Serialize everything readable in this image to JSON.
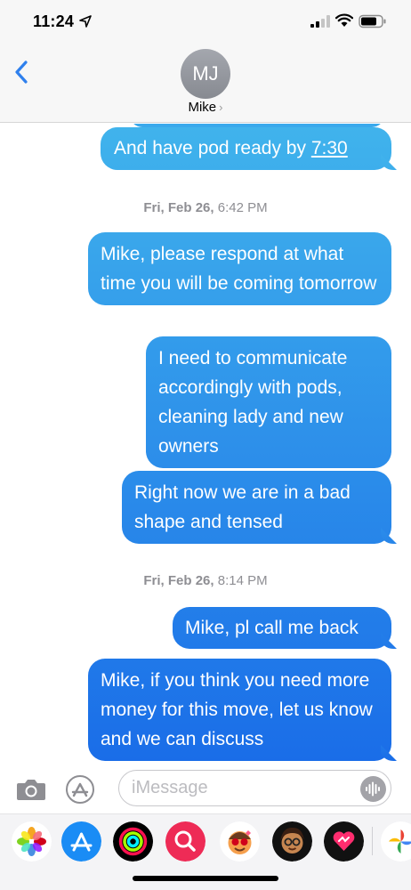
{
  "status_bar": {
    "time": "11:24"
  },
  "header": {
    "avatar_initials": "MJ",
    "contact_name": "Mike",
    "chevron": "›"
  },
  "messages": [
    {
      "type": "sent",
      "text_before": "And have pod ready by ",
      "link": "7:30"
    },
    {
      "type": "timestamp",
      "day": "Fri, Feb 26,",
      "time": "6:42 PM"
    },
    {
      "type": "sent",
      "text": "Mike, please respond at what time you will be coming tomorrow"
    },
    {
      "type": "sent",
      "text": "I need to communicate accordingly with pods, cleaning lady and new owners"
    },
    {
      "type": "sent",
      "text": "Right now we are in a bad shape and tensed"
    },
    {
      "type": "timestamp",
      "day": "Fri, Feb 26,",
      "time": "8:14 PM"
    },
    {
      "type": "sent",
      "text": "Mike, pl call me back"
    },
    {
      "type": "sent",
      "text": "Mike, if you think you need more money for this move, let us know and we can discuss"
    }
  ],
  "composer": {
    "placeholder": "iMessage"
  },
  "app_drawer": [
    "photos-app",
    "app-store-app",
    "fitness-app",
    "search-images-app",
    "memoji-stickers-app",
    "memoji-app",
    "digital-touch-app",
    "google-photos-app"
  ],
  "colors": {
    "bubble_top": "#40b3ec",
    "bubble_bottom": "#1a6de8",
    "accent": "#2f80ed"
  }
}
